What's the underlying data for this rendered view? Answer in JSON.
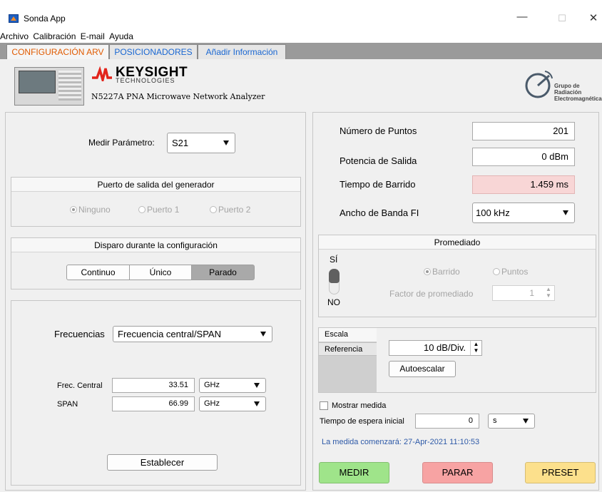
{
  "window": {
    "title": "Sonda App",
    "min_icon": "minimize-icon",
    "max_icon": "maximize-icon",
    "close_icon": "close-icon"
  },
  "menu": [
    "Archivo",
    "Calibración",
    "E-mail",
    "Ayuda"
  ],
  "tabs": [
    {
      "label": "CONFIGURACIÓN ARV",
      "active": true
    },
    {
      "label": "POSICIONADORES",
      "active": false
    },
    {
      "label": "Añadir Información",
      "active": false
    }
  ],
  "header": {
    "brand_name": "KEYSIGHT",
    "brand_sub": "TECHNOLOGIES",
    "instrument": "N5227A PNA Microwave Network Analyzer",
    "group_line1": "Grupo de",
    "group_line2": "Radiación",
    "group_line3": "Electromagnética"
  },
  "left": {
    "measure_label": "Medir Parámetro:",
    "measure_value": "S21",
    "port_group_title": "Puerto de salida del generador",
    "port_options": [
      "Ninguno",
      "Puerto 1",
      "Puerto 2"
    ],
    "port_selected": "Ninguno",
    "trigger_group_title": "Disparo durante la configuración",
    "trigger_buttons": [
      "Continuo",
      "Único",
      "Parado"
    ],
    "trigger_selected": "Parado",
    "freq_label": "Frecuencias",
    "freq_mode": "Frecuencia central/SPAN",
    "center_label": "Frec. Central",
    "center_value": "33.51",
    "center_unit": "GHz",
    "span_label": "SPAN",
    "span_value": "66.99",
    "span_unit": "GHz",
    "set_button": "Establecer"
  },
  "right": {
    "points_label": "Número de Puntos",
    "points_value": "201",
    "power_label": "Potencia de Salida",
    "power_value": "0 dBm",
    "sweep_label": "Tiempo de Barrido",
    "sweep_value": "1.459 ms",
    "ifbw_label": "Ancho de Banda FI",
    "ifbw_value": "100 kHz",
    "avg_title": "Promediado",
    "switch_on": "SÍ",
    "switch_off": "NO",
    "avg_options": [
      "Barrido",
      "Puntos"
    ],
    "avg_selected": "Barrido",
    "avg_factor_label": "Factor de promediado",
    "avg_factor_value": "1",
    "scale_tabs": [
      "Escala",
      "Referencia"
    ],
    "scale_active": "Referencia",
    "scale_value": "10 dB/Div.",
    "autoscale_button": "Autoescalar",
    "show_measure_label": "Mostrar medida",
    "wait_label": "Tiempo de espera inicial",
    "wait_value": "0",
    "wait_unit": "s",
    "start_message": "La medida comenzará: 27-Apr-2021 11:10:53",
    "measure_button": "MEDIR",
    "stop_button": "PARAR",
    "preset_button": "PRESET"
  },
  "colors": {
    "measure_btn": "#9fe48a",
    "stop_btn": "#f7a3a3",
    "preset_btn": "#fce08c",
    "sweep_bg": "#f8d6d6",
    "start_msg": "#2e5aa8",
    "active_tab": "#e05a00",
    "inactive_tab": "#1967d2"
  }
}
